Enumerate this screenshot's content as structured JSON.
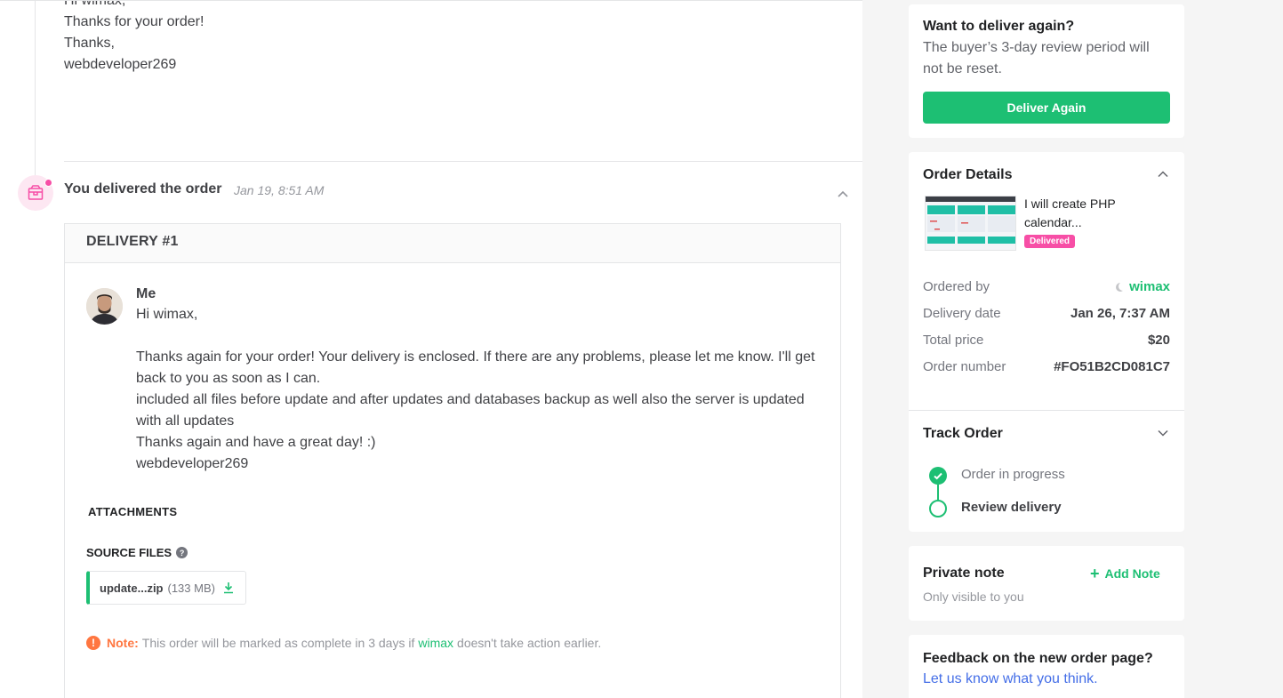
{
  "previous_message": {
    "lines": [
      "Hi wimax,",
      "",
      "Thanks for your order!",
      "",
      "Thanks,",
      "webdeveloper269"
    ]
  },
  "event": {
    "icon": "package-icon",
    "title": "You delivered the order",
    "time": "Jan 19, 8:51 AM"
  },
  "delivery": {
    "heading": "DELIVERY #1",
    "sender": "Me",
    "message_lines": [
      "Hi wimax,",
      "",
      "Thanks again for your order! Your delivery is enclosed. If there are any problems, please let me know. I'll get back to you as soon as I can.",
      "included all files before update and after updates and databases backup as well also the server is updated with all updates",
      "Thanks again and have a great day! :)",
      "webdeveloper269"
    ],
    "attachments_label": "ATTACHMENTS",
    "source_files_label": "SOURCE FILES",
    "file": {
      "name": "update...zip",
      "size": "(133 MB)"
    },
    "note": {
      "label": "Note:",
      "text_before": "This order will be marked as complete in 3 days if",
      "buyer": "wimax",
      "text_after": "doesn't take action earlier."
    }
  },
  "deliver_again": {
    "title": "Want to deliver again?",
    "text": "The buyer’s 3-day review period will not be reset.",
    "button": "Deliver Again"
  },
  "order_details": {
    "title": "Order Details",
    "gig_title": "I will create PHP calendar...",
    "status": "Delivered",
    "rows": [
      {
        "key": "Ordered by",
        "value": "wimax"
      },
      {
        "key": "Delivery date",
        "value": "Jan 26, 7:37 AM"
      },
      {
        "key": "Total price",
        "value": "$20"
      },
      {
        "key": "Order number",
        "value": "#FO51B2CD081C7"
      }
    ]
  },
  "track_order": {
    "title": "Track Order",
    "steps": [
      "Order in progress",
      "Review delivery"
    ]
  },
  "private_note": {
    "title": "Private note",
    "subtitle": "Only visible to you",
    "add_label": "Add Note"
  },
  "feedback": {
    "title": "Feedback on the new order page?",
    "link": "Let us know what you think."
  },
  "colors": {
    "accent": "#1dbf73",
    "badge": "#f74ea6",
    "warning": "#ff7640",
    "link": "#446ee7"
  }
}
